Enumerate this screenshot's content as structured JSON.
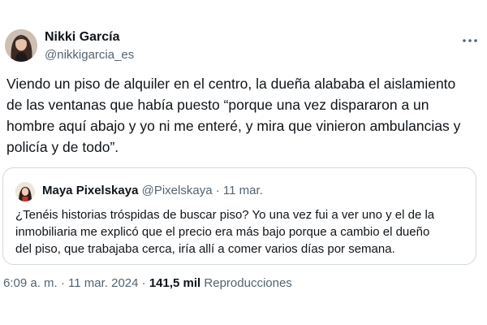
{
  "author": {
    "name": "Nikki García",
    "handle": "@nikkigarcia_es",
    "avatar_icon": "woman-portrait-avatar"
  },
  "more_icon": "more-horizontal-icon",
  "tweet_text": "Viendo un piso de alquiler en el centro, la dueña alababa el aislamiento\nde las ventanas que había puesto “porque una vez dispararon a un\nhombre aquí abajo y yo ni me enteré, y mira que vinieron ambulancias y\npolicía y de todo”.",
  "quote": {
    "name": "Maya Pixelskaya",
    "handle": "@Pixelskaya",
    "separator": " · ",
    "date": "11 mar.",
    "avatar_icon": "quote-author-avatar",
    "text": "¿Tenéis historias tróspidas de buscar piso? Yo una vez fui a ver uno y el de la\ninmobiliaria me explicó que el precio era más bajo porque a cambio el dueño\ndel piso, que trabajaba cerca, iría allí a comer varios días por semana."
  },
  "footer": {
    "time": "6:09 a. m.",
    "separator": " · ",
    "date": "11 mar. 2024",
    "views_count": "141,5 mil",
    "views_label": "Reproducciones"
  },
  "colors": {
    "text_primary": "#0f1419",
    "text_secondary": "#536471",
    "border": "#cfd9de"
  }
}
